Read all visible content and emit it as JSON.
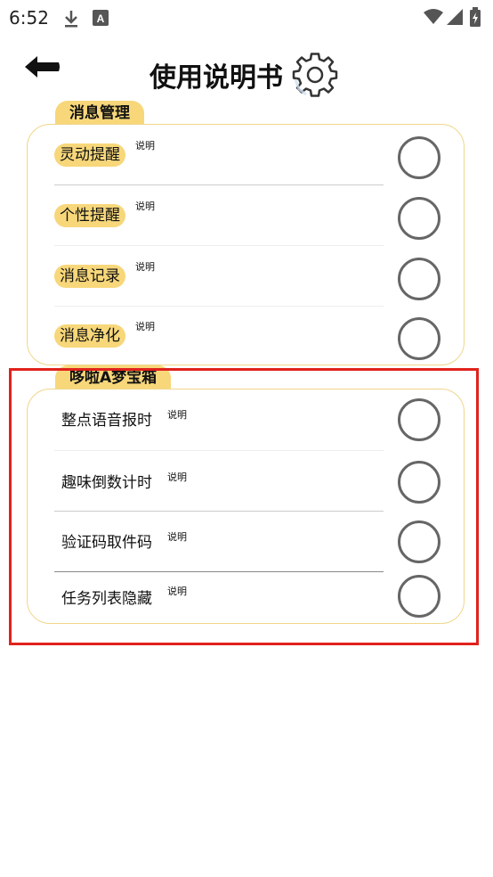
{
  "status_bar": {
    "time": "6:52",
    "icons": [
      "download-icon",
      "a-box-icon",
      "wifi-icon",
      "signal-icon",
      "battery-icon"
    ]
  },
  "header": {
    "title": "使用说明书",
    "back_icon": "back-arrow-icon",
    "settings_icon": "gear-icon"
  },
  "sections": [
    {
      "tag": "消息管理",
      "items": [
        {
          "label": "灵动提醒",
          "note": "说明"
        },
        {
          "label": "个性提醒",
          "note": "说明"
        },
        {
          "label": "消息记录",
          "note": "说明"
        },
        {
          "label": "消息净化",
          "note": "说明"
        }
      ]
    },
    {
      "tag": "哆啦A梦宝箱",
      "items": [
        {
          "label": "整点语音报时",
          "note": "说明"
        },
        {
          "label": "趣味倒数计时",
          "note": "说明"
        },
        {
          "label": "验证码取件码",
          "note": "说明"
        },
        {
          "label": "任务列表隐藏",
          "note": "说明"
        }
      ]
    }
  ],
  "colors": {
    "accent": "#f7d77a",
    "card_border": "#f0d68a",
    "highlight_border": "#e0221c",
    "toggle_border": "#666666"
  }
}
